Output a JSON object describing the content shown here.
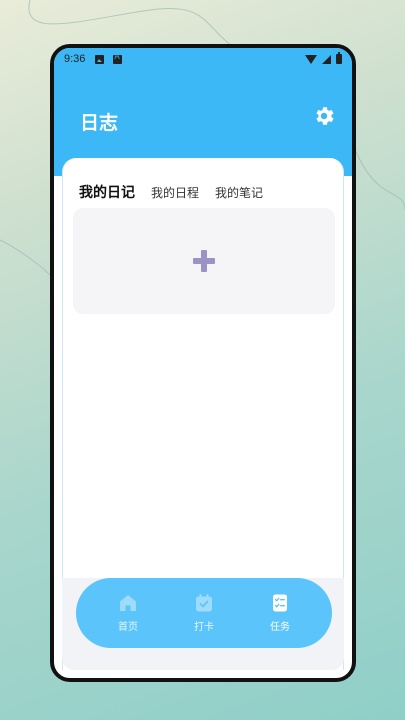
{
  "status_bar": {
    "time": "9:36",
    "icons": [
      "image-icon",
      "a-icon",
      "wifi-icon",
      "signal-icon",
      "battery-icon"
    ]
  },
  "header": {
    "title": "日志",
    "settings_icon": "gear-icon"
  },
  "tabs": [
    {
      "label": "我的日记",
      "active": true
    },
    {
      "label": "我的日程",
      "active": false
    },
    {
      "label": "我的笔记",
      "active": false
    }
  ],
  "add_entry": {
    "icon": "plus-icon"
  },
  "nav": [
    {
      "label": "首页",
      "icon": "home-icon",
      "active": false
    },
    {
      "label": "打卡",
      "icon": "calendar-check-icon",
      "active": false
    },
    {
      "label": "任务",
      "icon": "checklist-icon",
      "active": true
    }
  ],
  "colors": {
    "primary": "#3bb8f5",
    "nav_bar": "#5bc5fb",
    "plus": "#9b93c6",
    "card_bg": "#f5f5f8",
    "nav_icon": "#9edcfd"
  }
}
